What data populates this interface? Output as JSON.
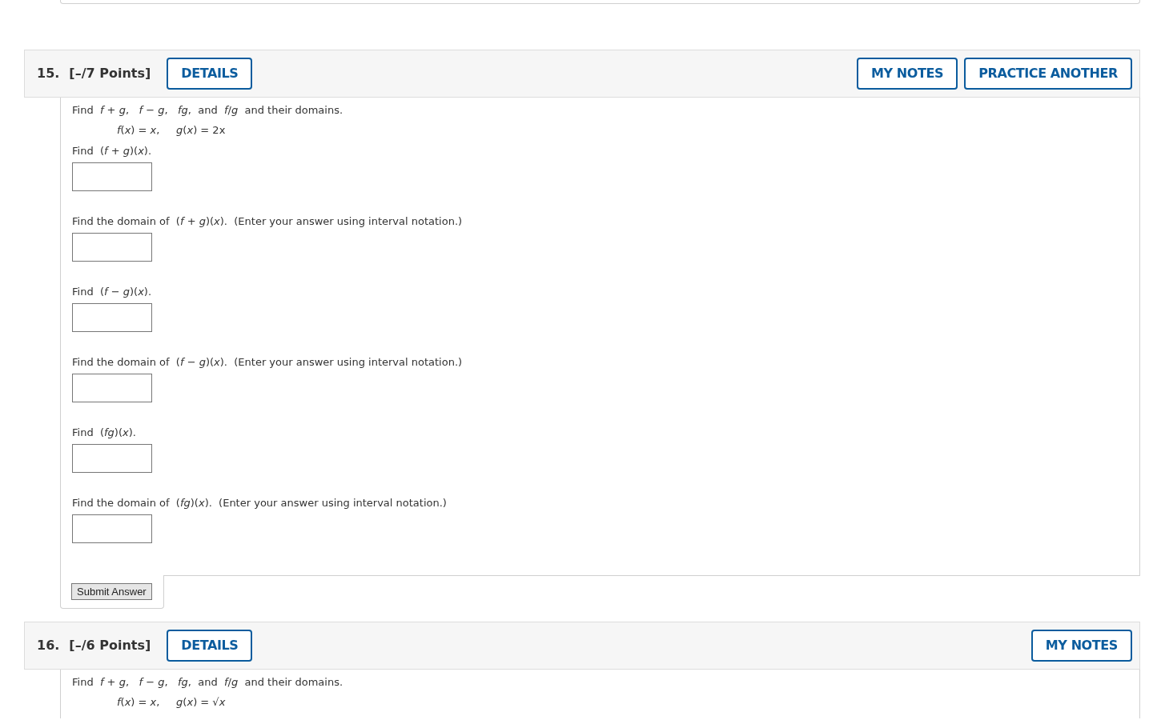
{
  "questions": [
    {
      "number": "15.",
      "points": "[–/7 Points]",
      "left_buttons": [
        "DETAILS"
      ],
      "right_buttons": [
        "MY NOTES",
        "PRACTICE ANOTHER"
      ],
      "intro": "Find  *f* + *g*,   *f* − *g*,   *fg*,  and  *f*/*g*  and their domains.",
      "given": "*f*(*x*) = *x*,     *g*(*x*) = 2x",
      "parts": [
        {
          "prompt": "Find  (*f* + *g*)(*x*)."
        },
        {
          "prompt": "Find the domain of  (*f* + *g*)(*x*).  (Enter your answer using interval notation.)"
        },
        {
          "prompt": "Find  (*f* − *g*)(*x*)."
        },
        {
          "prompt": "Find the domain of  (*f* − *g*)(*x*).  (Enter your answer using interval notation.)"
        },
        {
          "prompt": "Find  (*fg*)(*x*)."
        },
        {
          "prompt": "Find the domain of  (*fg*)(*x*).  (Enter your answer using interval notation.)"
        }
      ],
      "submit": "Submit Answer"
    },
    {
      "number": "16.",
      "points": "[–/6 Points]",
      "left_buttons": [
        "DETAILS"
      ],
      "right_buttons": [
        "MY NOTES"
      ],
      "intro": "Find  *f* + *g*,   *f* − *g*,   *fg*,  and  *f*/*g*  and their domains.",
      "given": "*f*(*x*) = *x*,     *g*(*x*) = √*x*"
    }
  ]
}
